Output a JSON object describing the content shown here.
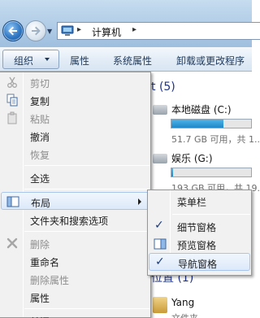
{
  "address_bar": {
    "separator": "▸",
    "location": "计算机"
  },
  "toolbar": {
    "organize_label": "组织",
    "items": [
      "属性",
      "系统属性",
      "卸载或更改程序"
    ]
  },
  "content": {
    "hard_disks_header": "t (5)",
    "drives": [
      {
        "name": "本地磁盘 (C:)",
        "free": "51.7 GB 可用，共 1...",
        "used_fraction": 0.65
      },
      {
        "name": "娱乐 (G:)",
        "free": "193 GB 可用，共 19...",
        "used_fraction": 0.02
      }
    ],
    "other_header": "位置 (1)",
    "user_item": {
      "name": "Yang",
      "type": "文件夹"
    }
  },
  "menu": {
    "items": [
      {
        "label": "剪切",
        "icon": "cut-icon",
        "disabled": true
      },
      {
        "label": "复制",
        "icon": "copy-icon",
        "disabled": false
      },
      {
        "label": "粘贴",
        "icon": "paste-icon",
        "disabled": true
      },
      {
        "label": "撤消",
        "disabled": false
      },
      {
        "label": "恢复",
        "disabled": true
      },
      {
        "label": "全选",
        "disabled": false
      },
      {
        "label": "布局",
        "icon": "layout-icon",
        "disabled": false,
        "submenu": true
      },
      {
        "label": "文件夹和搜索选项",
        "disabled": false
      },
      {
        "label": "删除",
        "icon": "delete-icon",
        "disabled": true
      },
      {
        "label": "重命名",
        "disabled": false
      },
      {
        "label": "删除属性",
        "disabled": true
      },
      {
        "label": "属性",
        "disabled": false
      },
      {
        "label": "关闭",
        "disabled": false
      }
    ]
  },
  "layout_submenu": {
    "items": [
      {
        "label": "菜单栏",
        "checked": false
      },
      {
        "label": "细节窗格",
        "checked": true
      },
      {
        "label": "预览窗格",
        "checked": false,
        "icon": "preview-pane-icon"
      },
      {
        "label": "导航窗格",
        "checked": true
      }
    ],
    "check_glyph": "✓"
  },
  "colors": {
    "accent": "#1e395b",
    "group_header": "#1e3287",
    "highlight_border": "#a9c5eb",
    "drive_bar": "#2a94d2"
  }
}
